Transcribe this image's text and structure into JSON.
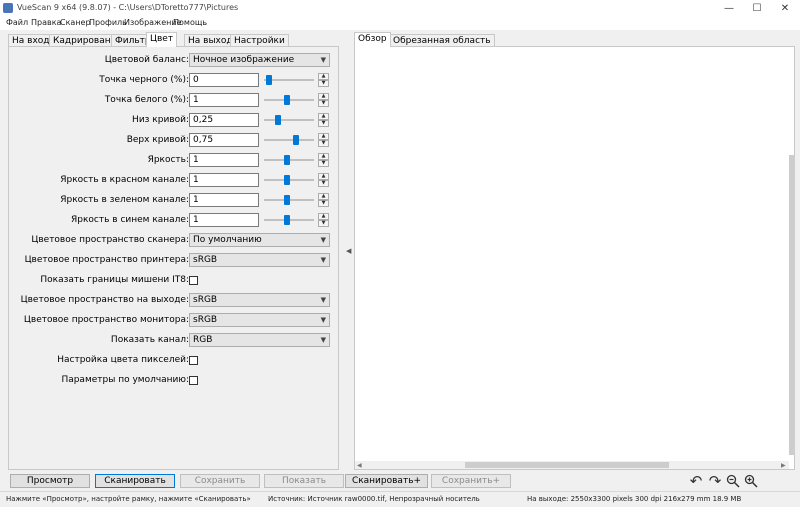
{
  "window": {
    "title": "VueScan 9 x64 (9.8.07) - C:\\Users\\DToretto777\\Pictures",
    "minimize": "—",
    "maximize": "☐",
    "close": "✕"
  },
  "menu": [
    "Файл",
    "Правка",
    "Сканер",
    "Профиль",
    "Изображение",
    "Помощь"
  ],
  "left_tabs": [
    "На входе",
    "Кадрирование",
    "Фильтр",
    "Цвет",
    "На выходе",
    "Настройки"
  ],
  "active_left_tab": "Цвет",
  "color": {
    "balance_label": "Цветовой баланс:",
    "balance_value": "Ночное изображение",
    "black_point_label": "Точка черного (%):",
    "black_point_value": "0",
    "black_point_level": 0.05,
    "white_point_label": "Точка белого (%):",
    "white_point_value": "1",
    "white_point_level": 0.45,
    "curve_low_label": "Низ кривой:",
    "curve_low_value": "0,25",
    "curve_low_level": 0.25,
    "curve_high_label": "Верх кривой:",
    "curve_high_value": "0,75",
    "curve_high_level": 0.65,
    "brightness_label": "Яркость:",
    "brightness_value": "1",
    "brightness_level": 0.45,
    "brightness_red_label": "Яркость в красном канале:",
    "brightness_red_value": "1",
    "brightness_red_level": 0.45,
    "brightness_green_label": "Яркость в зеленом канале:",
    "brightness_green_value": "1",
    "brightness_green_level": 0.45,
    "brightness_blue_label": "Яркость в синем канале:",
    "brightness_blue_value": "1",
    "brightness_blue_level": 0.45,
    "scanner_space_label": "Цветовое пространство сканера:",
    "scanner_space_value": "По умолчанию",
    "printer_space_label": "Цветовое пространство принтера:",
    "printer_space_value": "sRGB",
    "it8_label": "Показать границы мишени IT8:",
    "output_space_label": "Цветовое пространство на выходе:",
    "output_space_value": "sRGB",
    "monitor_space_label": "Цветовое пространство монитора:",
    "monitor_space_value": "sRGB",
    "channel_label": "Показать канал:",
    "channel_value": "RGB",
    "pixel_color_label": "Настройка цвета пикселей:",
    "defaults_label": "Параметры по умолчанию:"
  },
  "right_tabs": [
    "Обзор",
    "Обрезанная область"
  ],
  "active_right_tab": "Обзор",
  "buttons": {
    "preview": "Просмотр",
    "scan": "Сканировать",
    "save": "Сохранить",
    "show": "Показать",
    "scan_plus": "Сканировать+",
    "save_plus": "Сохранить+"
  },
  "status": {
    "hint": "Нажмите «Просмотр», настройте рамку, нажмите «Сканировать»",
    "source": "Источник: Источник raw0000.tif, Непрозрачный носитель",
    "output": "На выходе: 2550x3300 pixels 300 dpi 216x279 mm 18.9 MB"
  },
  "colors": {
    "accent": "#0078d7",
    "panel": "#f0f0f0"
  }
}
